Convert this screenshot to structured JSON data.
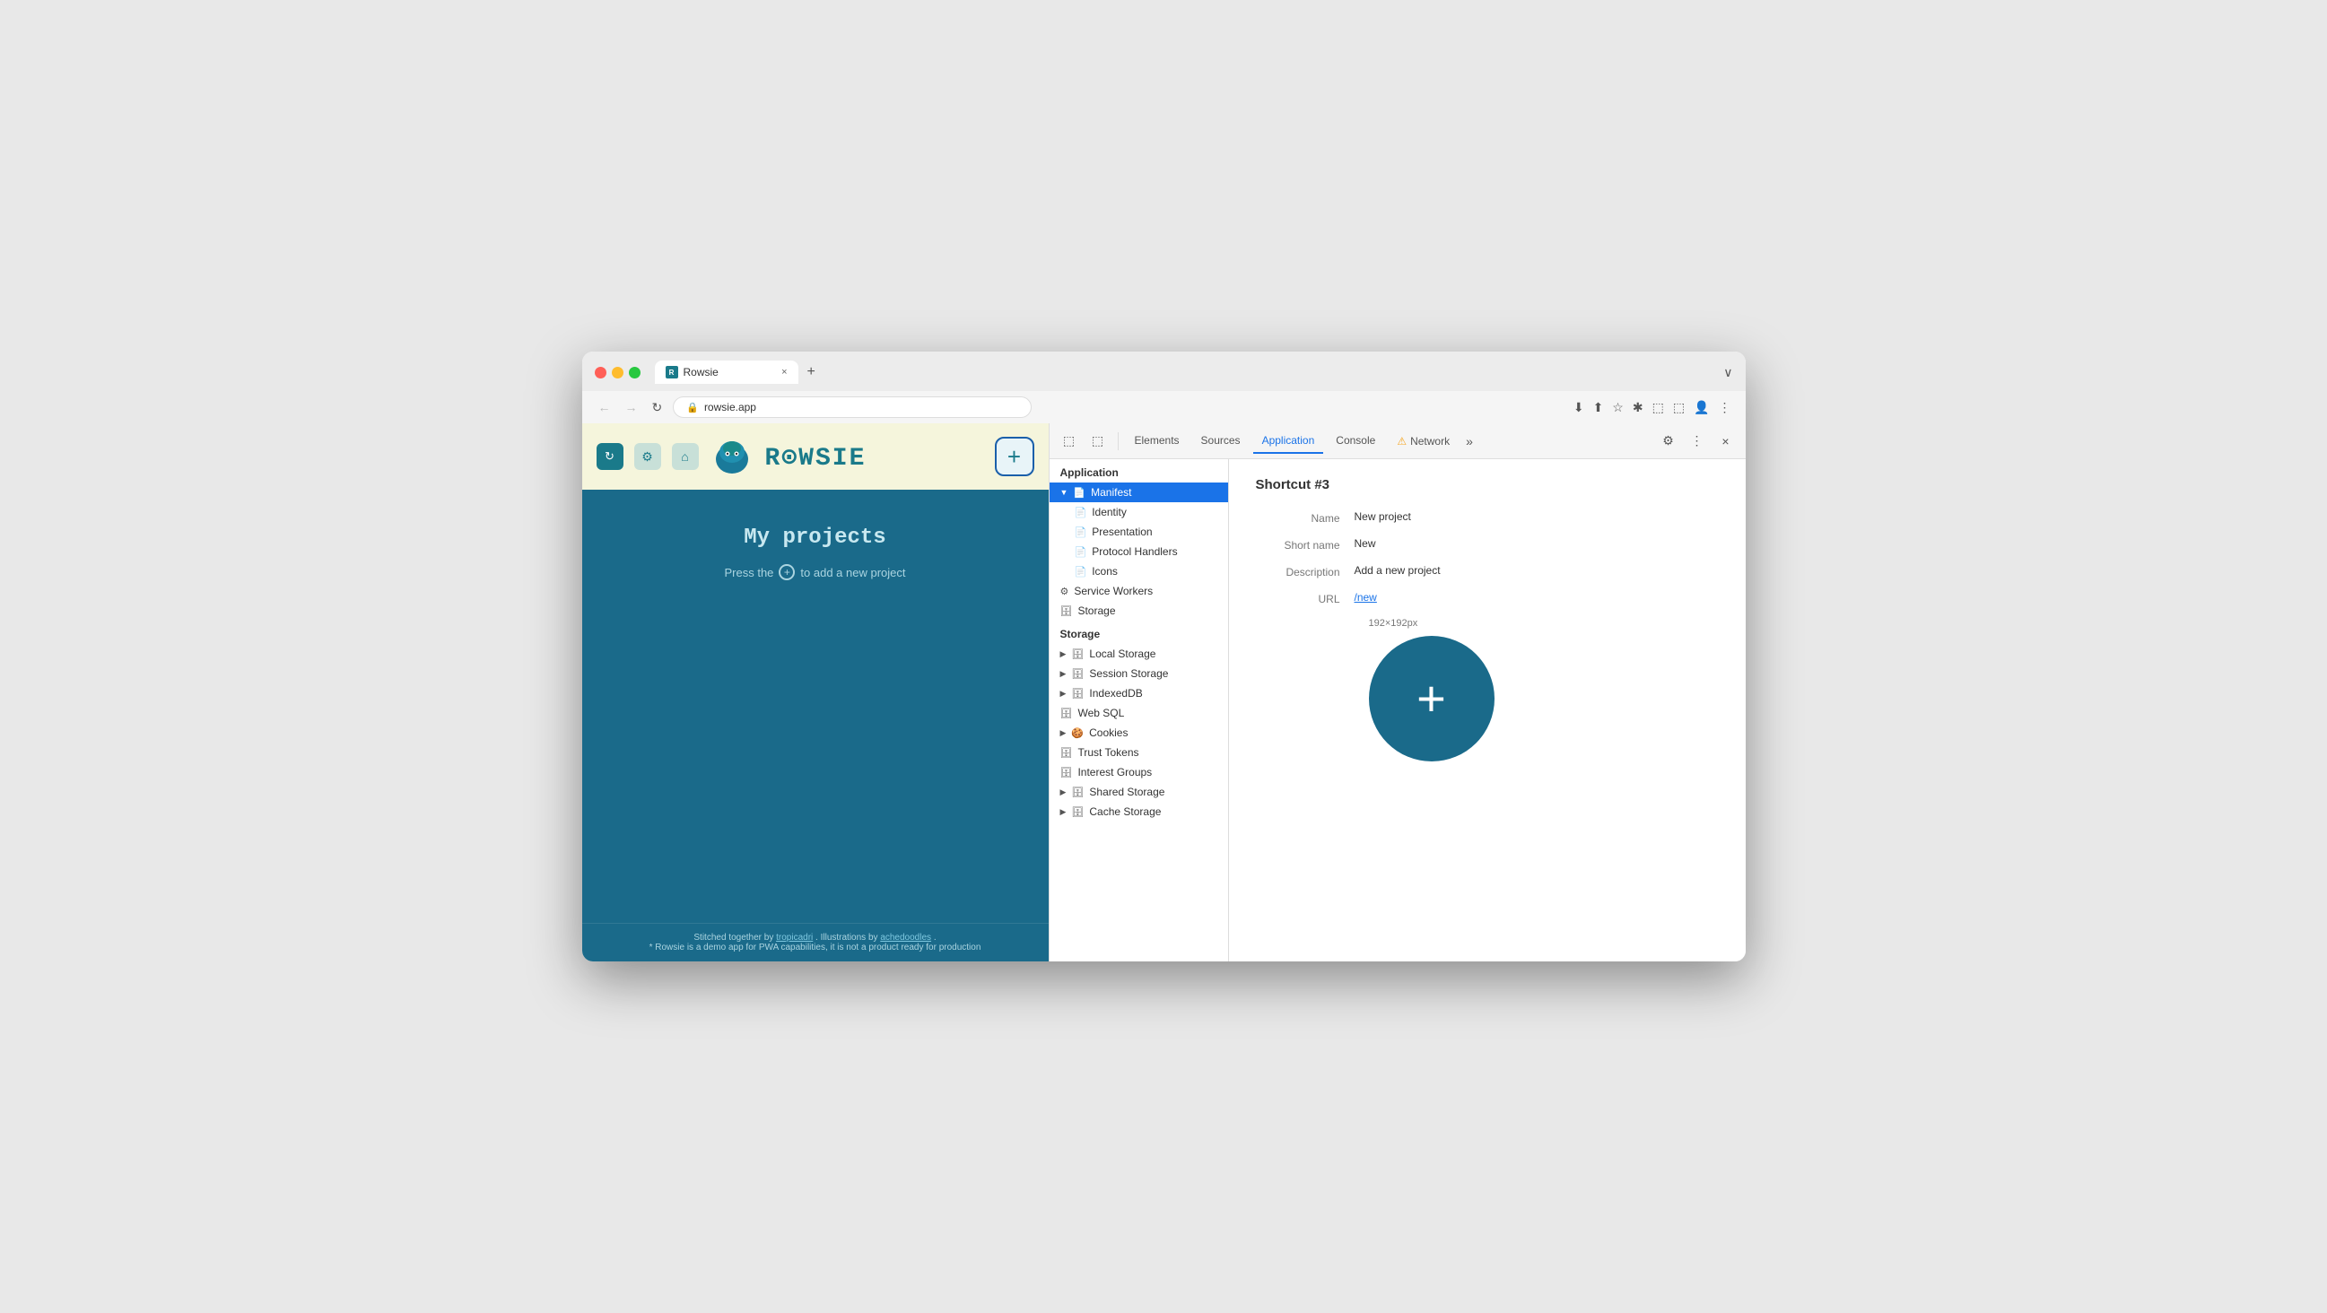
{
  "browser": {
    "traffic_lights": [
      "red",
      "yellow",
      "green"
    ],
    "tab": {
      "title": "Rowsie",
      "close": "×"
    },
    "new_tab": "+",
    "tab_overflow": "∨",
    "address": "rowsie.app",
    "nav": {
      "back": "←",
      "forward": "→",
      "reload": "↻"
    },
    "address_icons": [
      "⬇",
      "⬆",
      "☆",
      "✱",
      "🔔",
      "⬚",
      "👤",
      "⋮"
    ]
  },
  "website": {
    "header": {
      "logo": "ROWSIE",
      "add_btn": "+"
    },
    "body": {
      "title": "My projects",
      "instruction": "Press the",
      "instruction2": "to add a new project"
    },
    "footer": {
      "text1": "Stitched together by ",
      "link1": "tropicadri",
      "text2": ". Illustrations by ",
      "link2": "achedoodles",
      "text3": ".",
      "disclaimer": "* Rowsie is a demo app for PWA capabilities, it is not a product ready for production"
    }
  },
  "devtools": {
    "toolbar": {
      "cursor_icon": "⬚",
      "split_icon": "⬚",
      "tabs": [
        {
          "label": "Elements",
          "active": false
        },
        {
          "label": "Sources",
          "active": false
        },
        {
          "label": "Application",
          "active": true
        },
        {
          "label": "Console",
          "active": false
        },
        {
          "label": "Network",
          "active": false,
          "warning": true
        }
      ],
      "more": "»",
      "settings": "⚙",
      "menu": "⋮",
      "close": "×"
    },
    "sidebar": {
      "application_label": "Application",
      "manifest_item": "Manifest",
      "manifest_children": [
        {
          "label": "Identity"
        },
        {
          "label": "Presentation"
        },
        {
          "label": "Protocol Handlers"
        },
        {
          "label": "Icons"
        }
      ],
      "service_workers": "Service Workers",
      "storage_main": "Storage",
      "storage_label": "Storage",
      "storage_items": [
        {
          "label": "Local Storage",
          "expandable": true
        },
        {
          "label": "Session Storage",
          "expandable": true
        },
        {
          "label": "IndexedDB",
          "expandable": true
        },
        {
          "label": "Web SQL",
          "expandable": false
        },
        {
          "label": "Cookies",
          "expandable": true
        },
        {
          "label": "Trust Tokens",
          "expandable": false
        },
        {
          "label": "Interest Groups",
          "expandable": false
        },
        {
          "label": "Shared Storage",
          "expandable": true
        },
        {
          "label": "Cache Storage",
          "expandable": true
        }
      ]
    },
    "detail": {
      "shortcut_title": "Shortcut #3",
      "fields": [
        {
          "label": "Name",
          "value": "New project",
          "link": false
        },
        {
          "label": "Short name",
          "value": "New",
          "link": false
        },
        {
          "label": "Description",
          "value": "Add a new project",
          "link": false
        },
        {
          "label": "URL",
          "value": "/new",
          "link": true
        }
      ],
      "icon_size": "192×192px"
    }
  }
}
